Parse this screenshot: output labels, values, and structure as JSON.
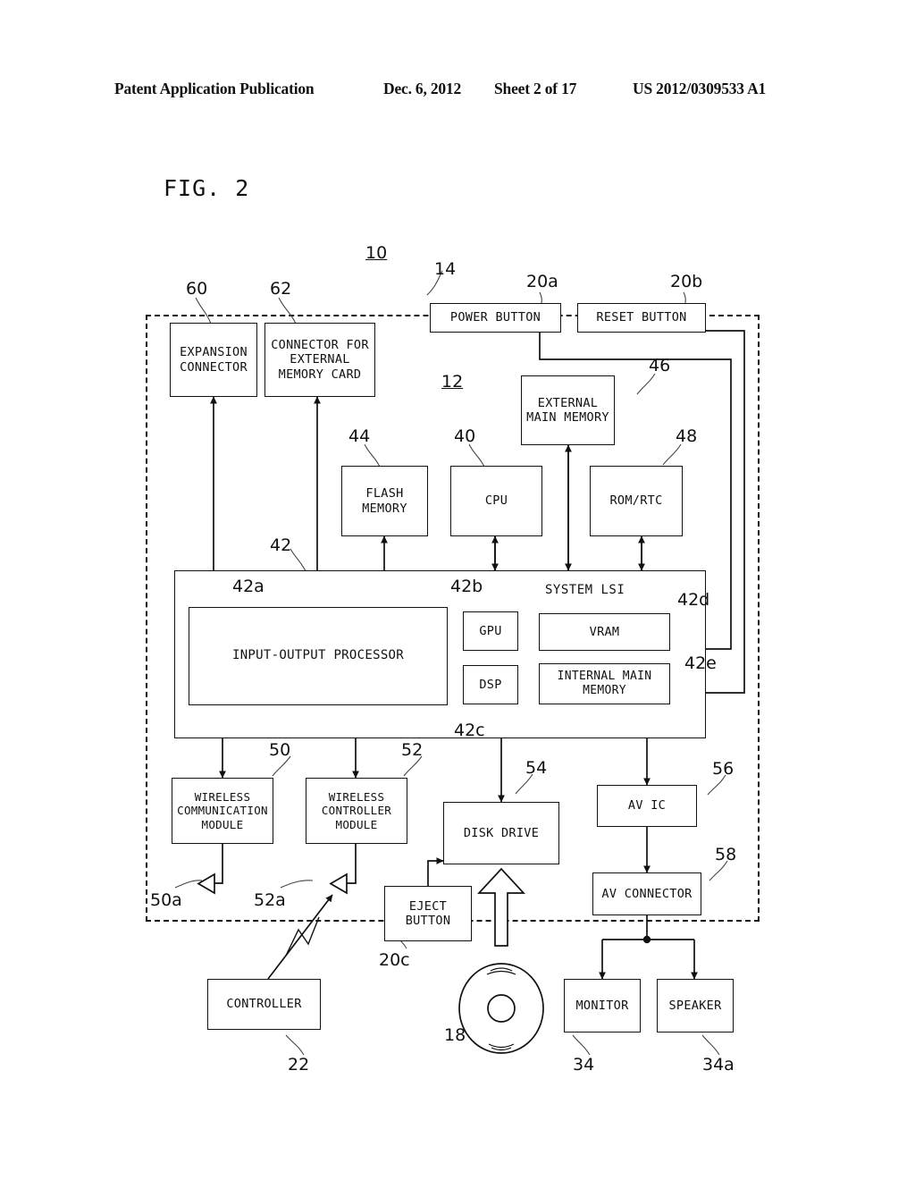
{
  "page_header": {
    "title": "Patent Application Publication",
    "date": "Dec. 6, 2012",
    "sheet": "Sheet 2 of 17",
    "pub_number": "US 2012/0309533 A1"
  },
  "figure": {
    "label": "FIG. 2",
    "system_ref": "10",
    "board_ref": "12",
    "housing_ref": "14"
  },
  "blocks": {
    "expansion_connector": {
      "label": "EXPANSION\nCONNECTOR",
      "ref": "60"
    },
    "memory_card_connector": {
      "label": "CONNECTOR FOR\nEXTERNAL\nMEMORY CARD",
      "ref": "62"
    },
    "power_button": {
      "label": "POWER BUTTON",
      "ref": "20a"
    },
    "reset_button": {
      "label": "RESET BUTTON",
      "ref": "20b"
    },
    "external_main_memory": {
      "label": "EXTERNAL\nMAIN MEMORY",
      "ref": "46"
    },
    "flash_memory": {
      "label": "FLASH\nMEMORY",
      "ref": "44"
    },
    "cpu": {
      "label": "CPU",
      "ref": "40"
    },
    "rom_rtc": {
      "label": "ROM/RTC",
      "ref": "48"
    },
    "system_lsi": {
      "label": "SYSTEM LSI",
      "ref": "42"
    },
    "io_processor": {
      "label": "INPUT-OUTPUT PROCESSOR",
      "ref": "42a"
    },
    "gpu": {
      "label": "GPU",
      "ref": "42b"
    },
    "dsp": {
      "label": "DSP",
      "ref": "42c"
    },
    "vram": {
      "label": "VRAM",
      "ref": "42d"
    },
    "internal_main_memory": {
      "label": "INTERNAL MAIN\nMEMORY",
      "ref": "42e"
    },
    "wireless_communication_module": {
      "label": "WIRELESS\nCOMMUNICATION\nMODULE",
      "ref": "50"
    },
    "wireless_controller_module": {
      "label": "WIRELESS\nCONTROLLER\nMODULE",
      "ref": "52"
    },
    "disk_drive": {
      "label": "DISK DRIVE",
      "ref": "54"
    },
    "av_ic": {
      "label": "AV IC",
      "ref": "56"
    },
    "av_connector": {
      "label": "AV CONNECTOR",
      "ref": "58"
    },
    "eject_button": {
      "label": "EJECT\nBUTTON",
      "ref": "20c"
    },
    "controller": {
      "label": "CONTROLLER",
      "ref": "22"
    },
    "monitor": {
      "label": "MONITOR",
      "ref": "34"
    },
    "speaker": {
      "label": "SPEAKER",
      "ref": "34a"
    },
    "optical_disc": {
      "label": "",
      "ref": "18"
    },
    "antenna_50a": {
      "label": "",
      "ref": "50a"
    },
    "antenna_52a": {
      "label": "",
      "ref": "52a"
    }
  }
}
